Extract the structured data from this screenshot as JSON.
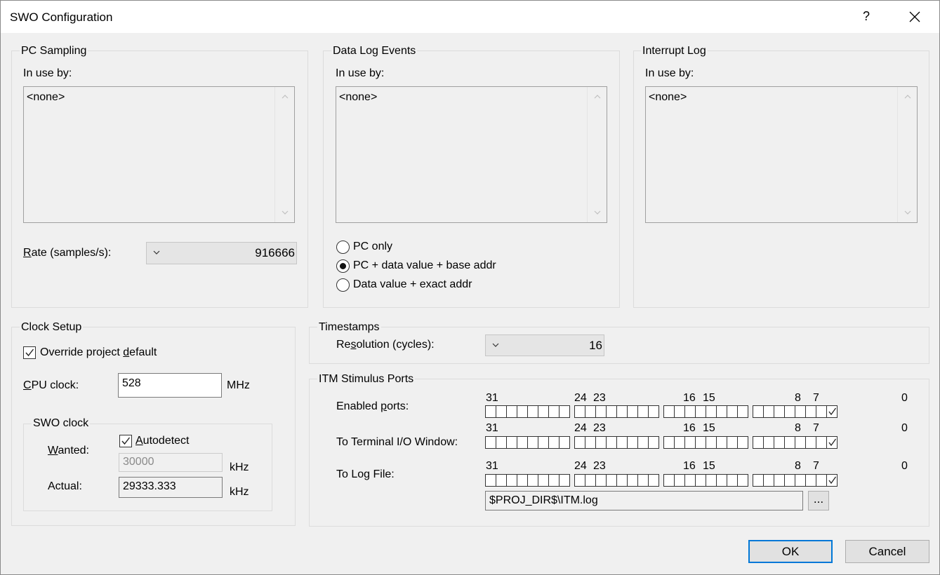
{
  "window": {
    "title": "SWO Configuration",
    "help": "?"
  },
  "pc_sampling": {
    "legend": "PC Sampling",
    "in_use_label": "In use by:",
    "list_item": "<none>",
    "rate_label_u": "R",
    "rate_label_rest": "ate (samples/s):",
    "rate_value": "916666"
  },
  "data_log": {
    "legend": "Data Log Events",
    "in_use_label": "In use by:",
    "list_item": "<none>",
    "options": [
      "PC only",
      "PC + data value + base addr",
      "Data value + exact addr"
    ],
    "selected_index": 1
  },
  "interrupt_log": {
    "legend": "Interrupt Log",
    "in_use_label": "In use by:",
    "list_item": "<none>"
  },
  "clock_setup": {
    "legend": "Clock Setup",
    "override_pre": "Override project ",
    "override_u": "d",
    "override_post": "efault",
    "override_checked": true,
    "cpu_label_u": "C",
    "cpu_label_rest": "PU clock:",
    "cpu_value": "528",
    "cpu_unit": "MHz",
    "swo": {
      "legend": "SWO clock",
      "autodetect_u": "A",
      "autodetect_rest": "utodetect",
      "autodetect_checked": true,
      "wanted_u": "W",
      "wanted_rest": "anted:",
      "wanted_value": "30000",
      "wanted_unit": "kHz",
      "actual_label": "Actual:",
      "actual_value": "29333.333",
      "actual_unit": "kHz"
    }
  },
  "timestamps": {
    "legend": "Timestamps",
    "resolution_pre": "Re",
    "resolution_u": "s",
    "resolution_post": "olution (cycles):",
    "resolution_value": "16"
  },
  "itm": {
    "legend": "ITM Stimulus Ports",
    "bit_labels": [
      "31",
      "24",
      "23",
      "16",
      "15",
      "8",
      "7",
      "0"
    ],
    "rows": [
      {
        "label_pre": "Enabled ",
        "label_u": "p",
        "label_post": "orts:",
        "checked_bits": [
          0
        ]
      },
      {
        "label_pre": "To Terminal I/O Window:",
        "label_u": "",
        "label_post": "",
        "checked_bits": [
          0
        ]
      },
      {
        "label_pre": "To Log File:",
        "label_u": "",
        "label_post": "",
        "checked_bits": [
          0
        ]
      }
    ],
    "log_file_path": "$PROJ_DIR$\\ITM.log",
    "browse_label": "..."
  },
  "buttons": {
    "ok": "OK",
    "cancel": "Cancel"
  }
}
